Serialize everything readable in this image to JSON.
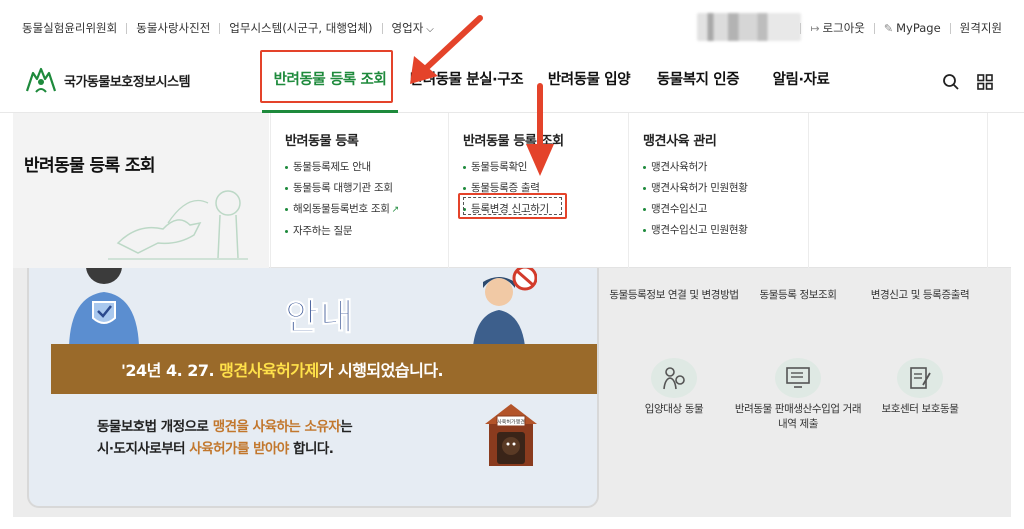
{
  "topbar": {
    "links": [
      "동물실험윤리위원회",
      "동물사랑사진전",
      "업무시스템(시군구, 대행업체)",
      "영업자"
    ],
    "right_links": [
      "로그아웃",
      "MyPage",
      "원격지원"
    ]
  },
  "logo": {
    "text": "국가동물보호정보시스템"
  },
  "nav": {
    "items": [
      "반려동물 등록 조회",
      "반려동물 분실·구조",
      "반려동물 입양",
      "동물복지 인증",
      "알림·자료"
    ]
  },
  "mega": {
    "title": "반려동물 등록 조회",
    "columns": [
      {
        "title": "반려동물 등록",
        "items": [
          "동물등록제도 안내",
          "동물등록 대행기관 조회",
          "해외동물등록번호 조회",
          "자주하는 질문"
        ]
      },
      {
        "title": "반려동물 등록 조회",
        "items": [
          "동물등록확인",
          "동물등록증 출력",
          "등록변경 신고하기"
        ]
      },
      {
        "title": "맹견사육 관리",
        "items": [
          "맹견사육허가",
          "맹견사육허가 민원현황",
          "맹견수입신고",
          "맹견수입신고 민원현황"
        ]
      }
    ]
  },
  "banner": {
    "title": "안내",
    "strip_pre": "'24년 4. 27. ",
    "strip_hl": "맹견사육허가제",
    "strip_post": "가 시행되었습니다.",
    "sub1_pre": "동물보호법 개정으로 ",
    "sub1_hl": "맹견을 사육하는 소유자",
    "sub1_post": "는",
    "sub2_pre": "시·도지사로부터 ",
    "sub2_hl": "사육허가를 받아야",
    "sub2_post": " 합니다.",
    "house_sign": "사육허가맹견"
  },
  "quick": {
    "row1": [
      "동물등록정보 연결 및 변경방법",
      "동물등록 정보조회",
      "변경신고 및 등록증출력"
    ],
    "row2": [
      "입양대상 동물",
      "반려동물 판매생산수입업 거래내역 제출",
      "보호센터 보호동물"
    ]
  },
  "colors": {
    "accent": "#1e8a3c",
    "annotation": "#e4432a"
  }
}
